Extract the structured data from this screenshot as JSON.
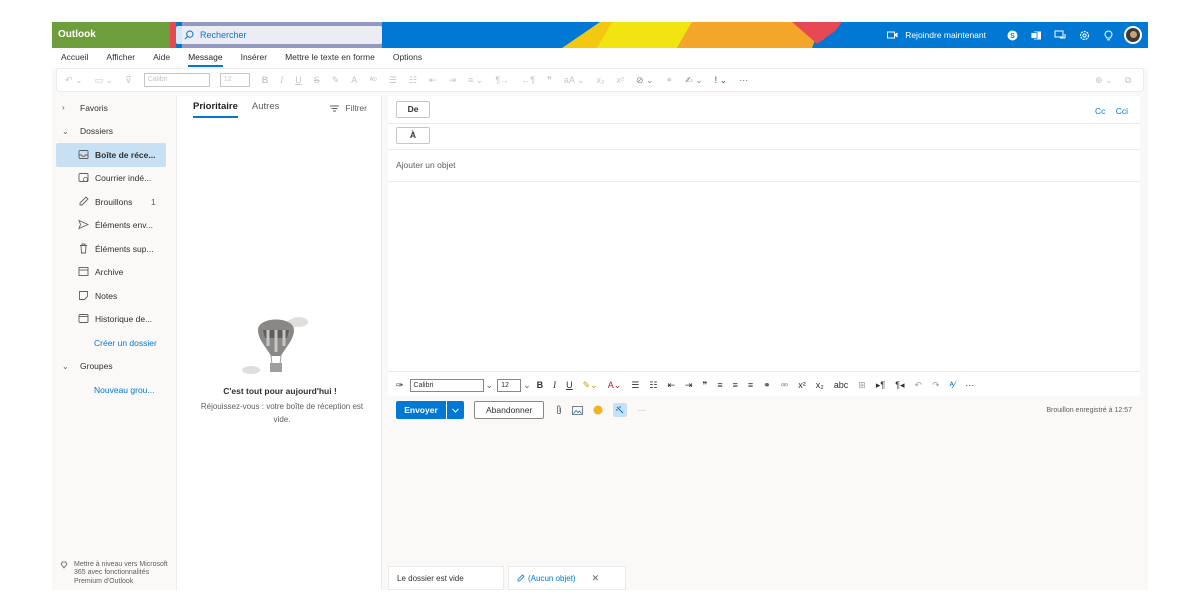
{
  "topbar": {
    "app_name": "Outlook",
    "search_placeholder": "Rechercher",
    "join_now": "Rejoindre maintenant",
    "brand_color": "#6d9e3b",
    "accent": "#0078d4"
  },
  "menu": {
    "items": [
      "Accueil",
      "Afficher",
      "Aide",
      "Message",
      "Insérer",
      "Mettre le texte en forme",
      "Options"
    ],
    "active": "Message"
  },
  "ribbon": {
    "font": "Calibri",
    "size": "12"
  },
  "nav": {
    "favorites": "Favoris",
    "folders": "Dossiers",
    "items": [
      {
        "label": "Boîte de réce...",
        "icon": "inbox-icon",
        "count": ""
      },
      {
        "label": "Courrier indé...",
        "icon": "junk-icon",
        "count": ""
      },
      {
        "label": "Brouillons",
        "icon": "drafts-icon",
        "count": "1"
      },
      {
        "label": "Éléments env...",
        "icon": "sent-icon",
        "count": ""
      },
      {
        "label": "Éléments sup...",
        "icon": "trash-icon",
        "count": ""
      },
      {
        "label": "Archive",
        "icon": "archive-icon",
        "count": ""
      },
      {
        "label": "Notes",
        "icon": "notes-icon",
        "count": ""
      },
      {
        "label": "Historique de...",
        "icon": "history-icon",
        "count": ""
      }
    ],
    "create_folder": "Créer un dossier",
    "groups": "Groupes",
    "new_group": "Nouveau grou...",
    "upsell": "Mettre à niveau vers Microsoft 365 avec fonctionnalités Premium d'Outlook"
  },
  "list": {
    "tab_focused": "Prioritaire",
    "tab_other": "Autres",
    "filter": "Filtrer",
    "empty_title": "C'est tout pour aujourd'hui !",
    "empty_sub": "Réjouissez-vous : votre boîte de réception est vide."
  },
  "compose": {
    "from": "De",
    "to": "À",
    "cc": "Cc",
    "bcc": "Cci",
    "subject_placeholder": "Ajouter un objet",
    "font": "Calibri",
    "size": "12",
    "send": "Envoyer",
    "discard": "Abandonner",
    "saved": "Brouillon enregistré à 12:57"
  },
  "bottom": {
    "tab1": "Le dossier est vide",
    "tab2": "(Aucun objet)"
  }
}
